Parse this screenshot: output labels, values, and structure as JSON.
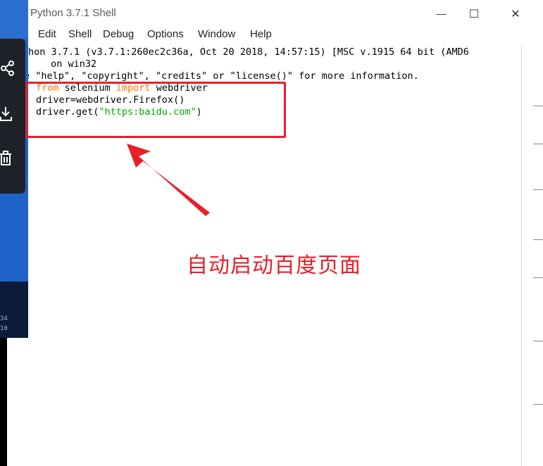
{
  "window": {
    "title": "Python 3.7.1 Shell",
    "controls": {
      "minimize": "—",
      "maximize": "☐",
      "close": "✕"
    }
  },
  "menu": [
    "Edit",
    "Shell",
    "Debug",
    "Options",
    "Window",
    "Help"
  ],
  "shell": {
    "banner_line1": "hon 3.7.1 (v3.7.1:260ec2c36a, Oct 20 2018, 14:57:15) [MSC v.1915 64 bit (AMD6",
    "banner_line2": " on win32",
    "banner_line3": "e \"help\", \"copyright\", \"credits\" or \"license()\" for more information.",
    "code": {
      "kw_from": "from",
      "mod": " selenium ",
      "kw_import": "import",
      "name": " webdriver",
      "line2": "driver=webdriver.Firefox()",
      "line3_prefix": "driver.get(",
      "line3_string": "\"https:baidu.com\"",
      "line3_suffix": ")"
    }
  },
  "annotation": {
    "text": "自动启动百度页面",
    "color": "#e8202a"
  },
  "side_panel": {
    "icons": [
      "share-icon",
      "download-icon",
      "trash-icon"
    ],
    "stamps": [
      "34",
      "10"
    ]
  },
  "colors": {
    "keyword": "#ff7700",
    "string": "#00aa00",
    "desktop": "#1e63c8"
  }
}
